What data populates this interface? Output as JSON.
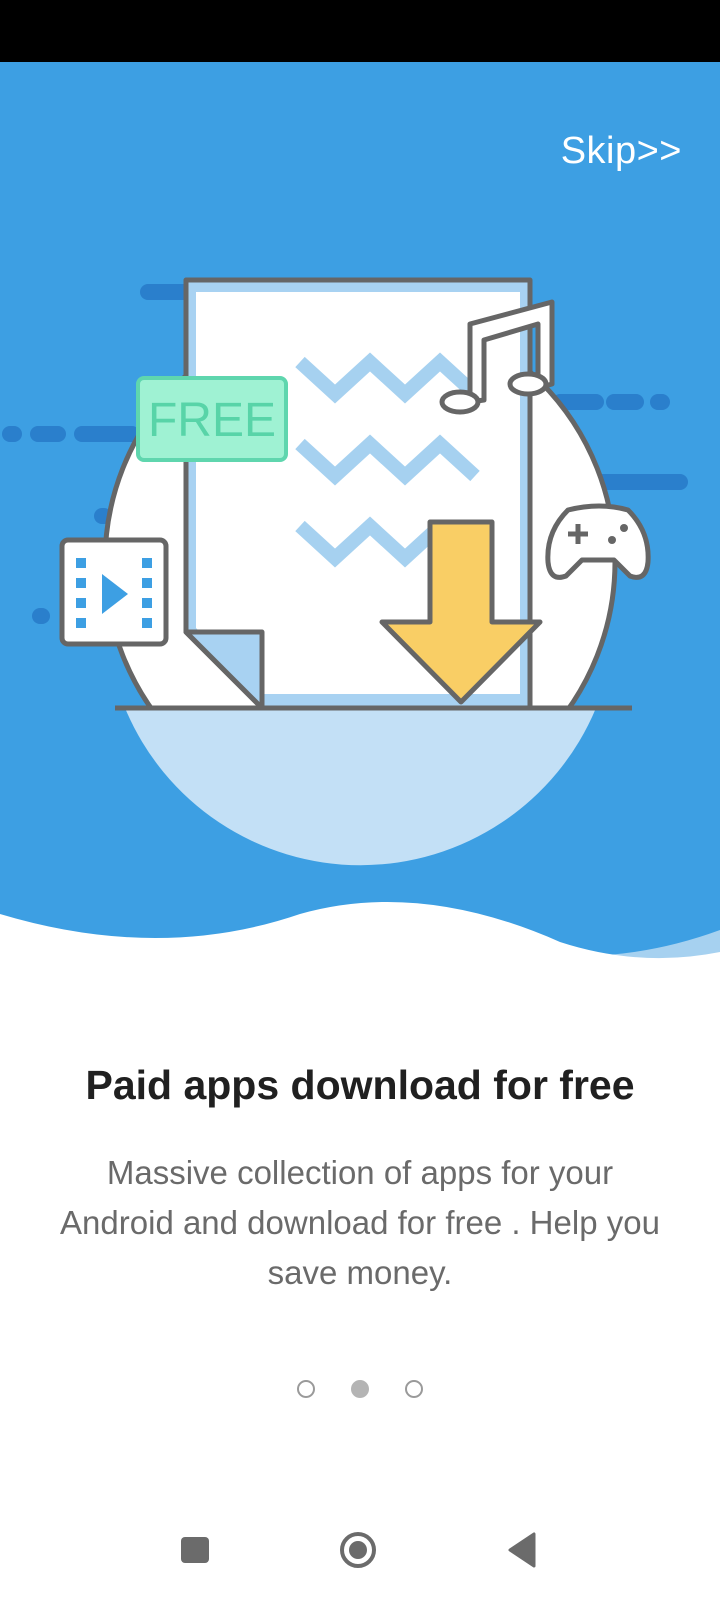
{
  "skip": {
    "label": "Skip>>"
  },
  "illustration": {
    "badge_text": "FREE"
  },
  "content": {
    "title": "Paid apps download for free",
    "description": "Massive collection of apps for your Android and download for free . Help you save money."
  },
  "pager": {
    "total": 3,
    "active_index": 1
  },
  "colors": {
    "hero_bg": "#3d9fe3",
    "badge": "#9ff2d3",
    "arrow": "#f9ce65",
    "accent": "#3d9fe3"
  },
  "nav": {
    "icons": [
      "recents-icon",
      "home-icon",
      "back-icon"
    ]
  }
}
